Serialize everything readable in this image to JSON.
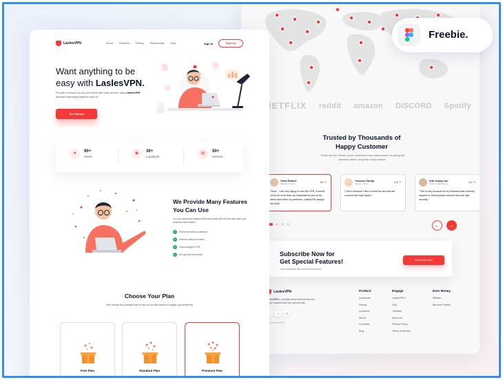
{
  "badge": {
    "label": "Freebie."
  },
  "nav": {
    "brand": "LaslesVPN",
    "links": [
      "About",
      "Features",
      "Pricing",
      "Testimonials",
      "Help"
    ],
    "sign_in": "Sign In",
    "sign_up": "Sign Up"
  },
  "hero": {
    "title_line1": "Want anything to be",
    "title_line2_prefix": "easy with ",
    "title_line2_brand": "LaslesVPN.",
    "desc_prefix": "Provide a network for all your needs with ease and fun using ",
    "desc_brand": "LaslesVPN",
    "desc_suffix": " discover interesting features from us.",
    "cta": "Get Started"
  },
  "stats": [
    {
      "value": "90+",
      "label": "Users",
      "icon": "user-icon"
    },
    {
      "value": "30+",
      "label": "Locations",
      "icon": "location-icon"
    },
    {
      "value": "50+",
      "label": "Servers",
      "icon": "server-icon"
    }
  ],
  "features": {
    "title": "We Provide Many Features You Can Use",
    "desc": "You can explore the features that we provide with fun and have their own functions each feature.",
    "items": [
      "Powerfull online protection.",
      "Internet without borders.",
      "Supercharged VPN",
      "No specific time limits."
    ]
  },
  "plans": {
    "title": "Choose Your Plan",
    "desc": "Let's choose the package that is best for you and explore it happily and cheerfully.",
    "cards": [
      {
        "name": "Free Plan"
      },
      {
        "name": "Standard Plan"
      },
      {
        "name": "Premium Plan"
      }
    ]
  },
  "partners": [
    "NETFLIX",
    "reddit",
    "amazon",
    "DISCORD",
    "Spotify"
  ],
  "trusted": {
    "title_line1": "Trusted by Thousands of",
    "title_line2": "Happy Customer",
    "desc": "These are the stories of our customers who have joined us with great pleasure when using this crazy feature."
  },
  "reviews": [
    {
      "name": "Viezh Robert",
      "location": "Warsaw, Poland",
      "rating": "4.5",
      "text": "“Wow... I am very happy to use this VPN, it turned out to be more than my expectations and so far there have been no problems. LaslesVPN always the best”."
    },
    {
      "name": "Yessica Christy",
      "location": "Shanxi, China",
      "rating": "4.5",
      "text": "“I like it because I like to travel far and still can connect with high speed.”."
    },
    {
      "name": "Kim Young Jou",
      "location": "Seoul, South Korea",
      "rating": "4.5",
      "text": "“This is very unusual for my business that currently requires a virtual private network that has high security.”."
    }
  ],
  "subscribe": {
    "title_line1": "Subscribe Now for",
    "title_line2": "Get Special Features!",
    "desc": "Let's subscribe with us and find the fun.",
    "button": "Subscribe Now"
  },
  "footer": {
    "brand": "LaslesVPN",
    "desc_brand": "LaslesVPN",
    "desc": " is a private virtual network that has unique features and has high security.",
    "copyright": "©2020LaslesVPN",
    "columns": [
      {
        "title": "Product",
        "items": [
          "Download",
          "Pricing",
          "Locations",
          "Server",
          "Countries",
          "Blog"
        ]
      },
      {
        "title": "Engage",
        "items": [
          "LaslesVPN ?",
          "FAQ",
          "Tutorials",
          "About Us",
          "Privacy Policy",
          "Terms of Service"
        ]
      },
      {
        "title": "Earn Money",
        "items": [
          "Affiliate",
          "Become Partner"
        ]
      }
    ]
  },
  "colors": {
    "accent": "#F53838",
    "dark": "#0B132A",
    "frame": "#2F8FF0",
    "check": "#2FAB73"
  }
}
